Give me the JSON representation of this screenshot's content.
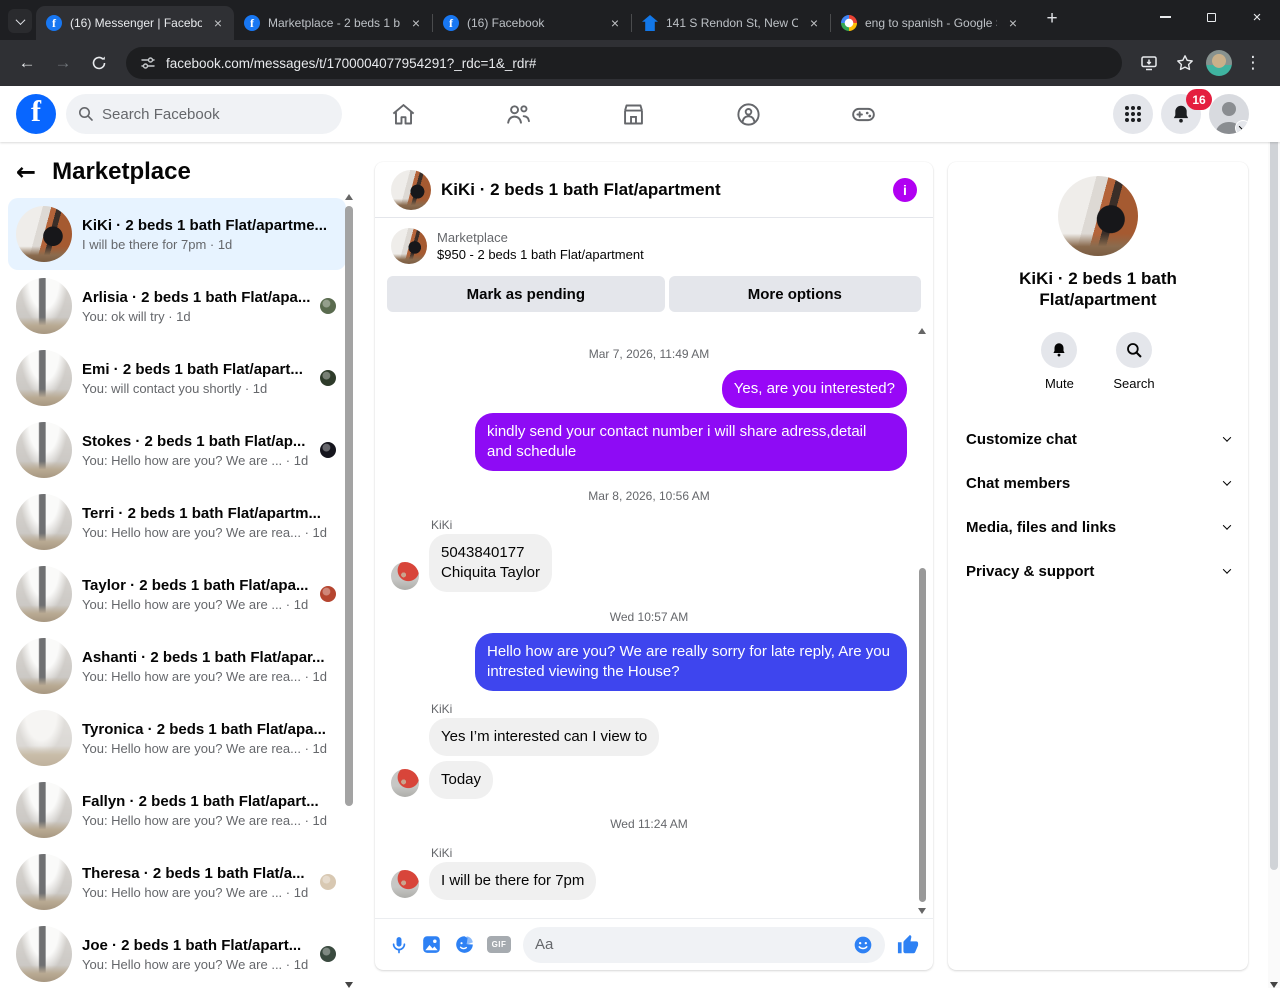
{
  "browser": {
    "tabs": [
      {
        "title": "(16) Messenger | Faceboo",
        "favicon": "facebook",
        "active": true
      },
      {
        "title": "Marketplace - 2 beds 1 b",
        "favicon": "facebook",
        "active": false
      },
      {
        "title": "(16) Facebook",
        "favicon": "facebook",
        "active": false
      },
      {
        "title": "141 S Rendon St, New Or",
        "favicon": "zillow",
        "active": false
      },
      {
        "title": "eng to spanish - Google S",
        "favicon": "google",
        "active": false
      }
    ],
    "url": "facebook.com/messages/t/1700004077954291?_rdc=1&_rdr#"
  },
  "header": {
    "search_placeholder": "Search Facebook",
    "notification_badge": "16"
  },
  "sidebar": {
    "title": "Marketplace",
    "conversations": [
      {
        "name": "KiKi · 2 beds 1 bath Flat/apartme...",
        "preview": "I will be there for 7pm · 1d",
        "avatar": "kitchen",
        "selected": true
      },
      {
        "name": "Arlisia · 2 beds 1 bath Flat/apa...",
        "preview": "You: ok will try · 1d",
        "avatar": "grayroom",
        "seen_color": "#5a6b4f"
      },
      {
        "name": "Emi · 2 beds 1 bath Flat/apart...",
        "preview": "You: will contact you shortly · 1d",
        "avatar": "grayroom",
        "seen_color": "#2e3b2a"
      },
      {
        "name": "Stokes · 2 beds 1 bath Flat/ap...",
        "preview": "You: Hello how are you? We are ... · 1d",
        "avatar": "grayroom",
        "seen_color": "#15151d"
      },
      {
        "name": "Terri · 2 beds 1 bath Flat/apartm...",
        "preview": "You: Hello how are you? We are rea... · 1d",
        "avatar": "grayroom"
      },
      {
        "name": "Taylor · 2 beds 1 bath Flat/apa...",
        "preview": "You: Hello how are you? We are ... · 1d",
        "avatar": "grayroom",
        "seen_color": "#b5452f"
      },
      {
        "name": "Ashanti · 2 beds 1 bath Flat/apar...",
        "preview": "You: Hello how are you? We are rea... · 1d",
        "avatar": "grayroom"
      },
      {
        "name": "Tyronica · 2 beds 1 bath Flat/apa...",
        "preview": "You: Hello how are you? We are rea... · 1d",
        "avatar": "emptyroom"
      },
      {
        "name": "Fallyn · 2 beds 1 bath Flat/apart...",
        "preview": "You: Hello how are you? We are rea... · 1d",
        "avatar": "grayroom"
      },
      {
        "name": "Theresa · 2 beds 1 bath Flat/a...",
        "preview": "You: Hello how are you? We are ... · 1d",
        "avatar": "grayroom",
        "seen_color": "#d8c8b2"
      },
      {
        "name": "Joe · 2 beds 1 bath Flat/apart...",
        "preview": "You: Hello how are you? We are ... · 1d",
        "avatar": "grayroom",
        "seen_color": "#3a4a3f"
      }
    ]
  },
  "chat": {
    "title": "KiKi · 2 beds 1 bath Flat/apartment",
    "banner": {
      "source": "Marketplace",
      "listing": "$950 - 2 beds 1 bath Flat/apartment",
      "primary_button": "Mark as pending",
      "secondary_button": "More options"
    },
    "messages": [
      {
        "type": "timestamp",
        "text": "Mar 7, 2026, 11:49 AM"
      },
      {
        "type": "out",
        "text": "Yes, are you interested?",
        "color": "#9807f7"
      },
      {
        "type": "out",
        "text": "kindly send your contact number i will share adress,detail and schedule",
        "color": "#8e0bf5"
      },
      {
        "type": "timestamp",
        "text": "Mar 8, 2026, 10:56 AM"
      },
      {
        "type": "label",
        "text": "KiKi"
      },
      {
        "type": "in",
        "text": "5043840177\nChiquita Taylor",
        "avatar": true
      },
      {
        "type": "timestamp",
        "text": "Wed 10:57 AM"
      },
      {
        "type": "out",
        "text": "Hello how are you? We are really sorry for late reply, Are you intrested viewing the House?",
        "color": "#3e45ee"
      },
      {
        "type": "label",
        "text": "KiKi"
      },
      {
        "type": "in",
        "text": "Yes I’m interested can I view to"
      },
      {
        "type": "in",
        "text": "Today",
        "avatar": true
      },
      {
        "type": "timestamp",
        "text": "Wed 11:24 AM"
      },
      {
        "type": "label",
        "text": "KiKi"
      },
      {
        "type": "in",
        "text": "I will be there for 7pm",
        "avatar": true
      }
    ],
    "composer_placeholder": "Aa"
  },
  "right_panel": {
    "title": "KiKi · 2 beds 1 bath Flat/apartment",
    "actions": [
      {
        "label": "Mute",
        "icon": "bell"
      },
      {
        "label": "Search",
        "icon": "magnifier"
      }
    ],
    "menu": [
      "Customize chat",
      "Chat members",
      "Media, files and links",
      "Privacy & support"
    ]
  },
  "colors": {
    "outgoing_purple_1": "#9807f7",
    "outgoing_purple_2": "#8e0bf5",
    "outgoing_blue": "#3e45ee",
    "incoming_gray": "#f0f0f0",
    "info_icon_purple": "#b100f2",
    "badge_red": "#e41e3f",
    "composer_blue": "#2e81f4",
    "facebook_blue": "#0866ff",
    "selected_conversation_bg": "#e7f3ff"
  }
}
